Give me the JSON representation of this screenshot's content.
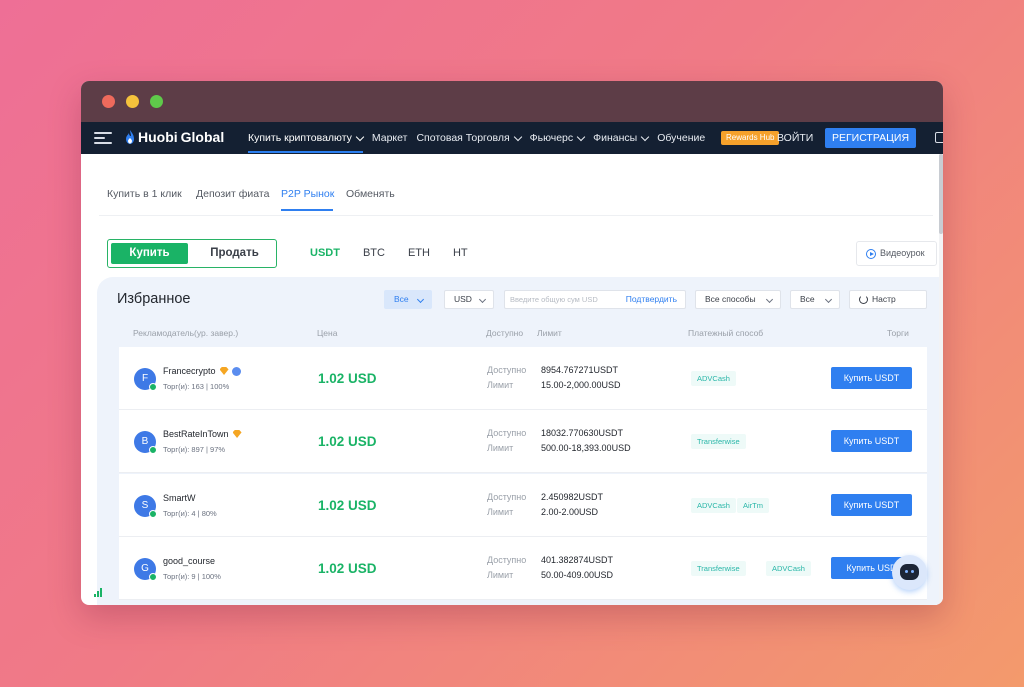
{
  "navbar": {
    "logo_huobi": "Huobi",
    "logo_global": "Global",
    "items": [
      {
        "label": "Купить криптовалюту",
        "has_dropdown": true,
        "active": true
      },
      {
        "label": "Маркет",
        "has_dropdown": false
      },
      {
        "label": "Спотовая Торговля",
        "has_dropdown": true
      },
      {
        "label": "Фьючерс",
        "has_dropdown": true
      },
      {
        "label": "Финансы",
        "has_dropdown": true
      },
      {
        "label": "Обучение",
        "has_dropdown": false
      }
    ],
    "rewards_badge": "Rewards Hub",
    "login_label": "ВОЙТИ",
    "register_label": "РЕГИСТРАЦИЯ"
  },
  "subtabs": [
    {
      "label": "Купить в 1 клик"
    },
    {
      "label": "Депозит фиата"
    },
    {
      "label": "P2P Рынок",
      "active": true
    },
    {
      "label": "Обменять"
    }
  ],
  "trade_toggle": {
    "buy_label": "Купить",
    "sell_label": "Продать",
    "selected": "buy"
  },
  "coins": [
    {
      "label": "USDT",
      "active": true
    },
    {
      "label": "BTC"
    },
    {
      "label": "ETH"
    },
    {
      "label": "HT"
    }
  ],
  "video_button_label": "Видеоурок",
  "filters": {
    "title": "Избранное",
    "all_label": "Все",
    "currency_label": "USD",
    "amount_placeholder": "Введите общую сум USD",
    "confirm_label": "Подтвердить",
    "methods_label": "Все способы",
    "all2_label": "Все",
    "settings_label": "Настр"
  },
  "table": {
    "headers": {
      "advertiser": "Рекламодатель(ур. завер.)",
      "price": "Цена",
      "available": "Доступно",
      "limit": "Лимит",
      "payment": "Платежный способ",
      "trade": "Торги"
    },
    "available_label": "Доступно",
    "limit_label": "Лимит",
    "rows": [
      {
        "initial": "F",
        "name": "Francecrypto",
        "gold_badge": true,
        "blue_badge": true,
        "trades": "Торг(и): 163 | 100%",
        "price": "1.02 USD",
        "available": "8954.767271USDT",
        "limit": "15.00-2,000.00USD",
        "payments": [
          "ADVCash"
        ],
        "button_label": "Купить USDT"
      },
      {
        "initial": "B",
        "name": "BestRateInTown",
        "gold_badge": true,
        "blue_badge": false,
        "trades": "Торг(и): 897 | 97%",
        "price": "1.02 USD",
        "available": "18032.770630USDT",
        "limit": "500.00-18,393.00USD",
        "payments": [
          "Transferwise"
        ],
        "button_label": "Купить USDT"
      },
      {
        "initial": "S",
        "name": "SmartW",
        "gold_badge": false,
        "blue_badge": false,
        "trades": "Торг(и): 4 | 80%",
        "price": "1.02 USD",
        "available": "2.450982USDT",
        "limit": "2.00-2.00USD",
        "payments": [
          "ADVCash",
          "AirTm"
        ],
        "button_label": "Купить USDT"
      },
      {
        "initial": "G",
        "name": "good_course",
        "gold_badge": false,
        "blue_badge": false,
        "trades": "Торг(и): 9 | 100%",
        "price": "1.02 USD",
        "available": "401.382874USDT",
        "limit": "50.00-409.00USD",
        "payments": [
          "Transferwise",
          "ADVCash"
        ],
        "button_label": "Купить USD"
      }
    ]
  },
  "colors": {
    "navbar_bg": "#142032",
    "accent_blue": "#2f7ff0",
    "buy_green": "#1ab366",
    "rewards_orange": "#f5a12b",
    "payment_teal": "#29b6a8"
  }
}
